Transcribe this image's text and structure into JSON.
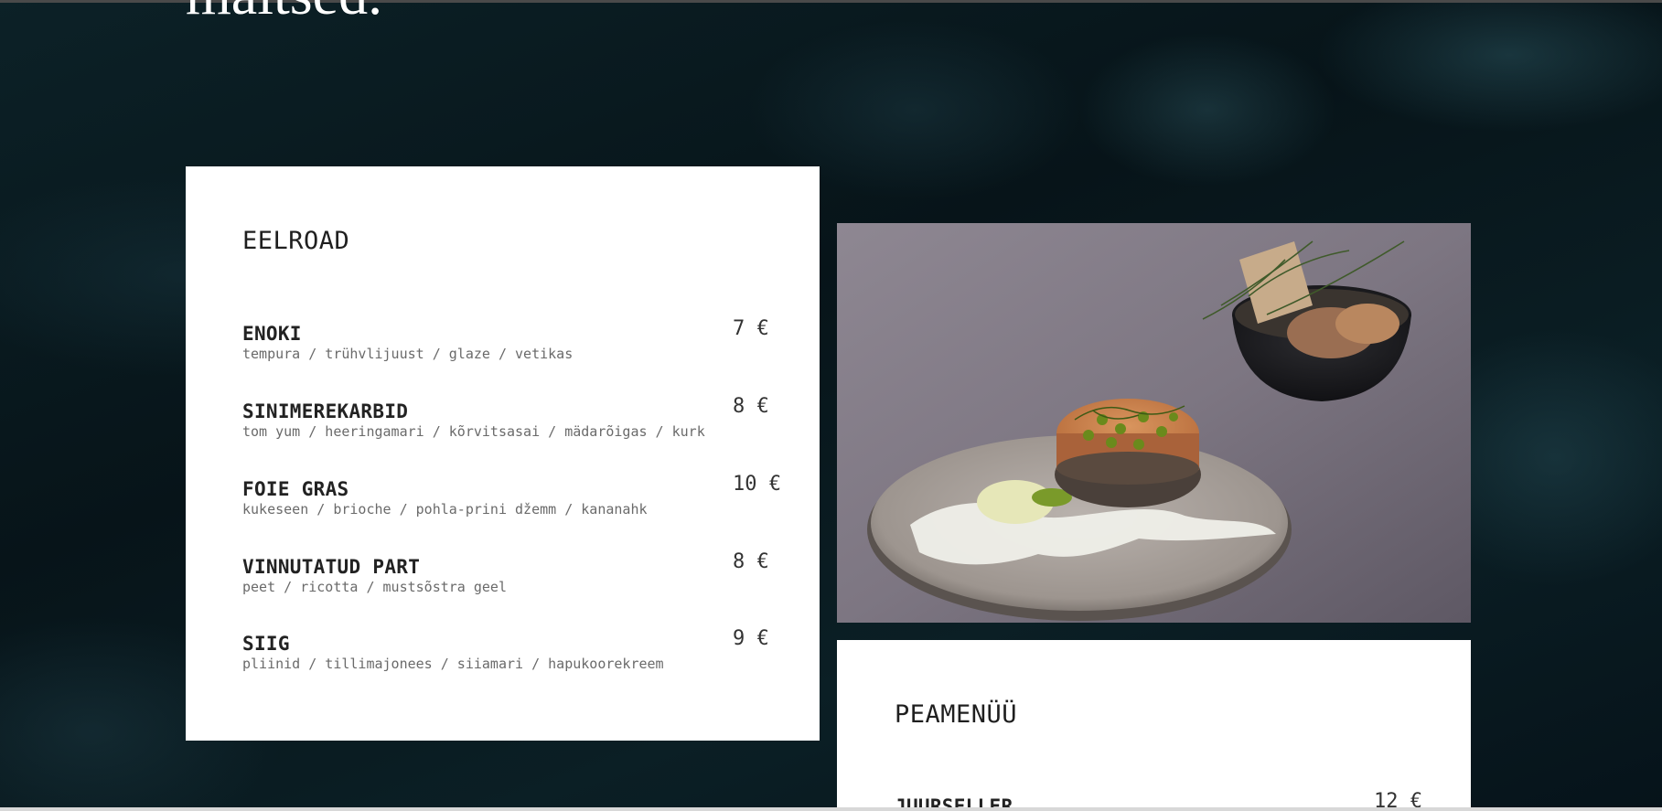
{
  "page": {
    "heading": "maitsed."
  },
  "starters": {
    "title": "EELROAD",
    "items": [
      {
        "name": "ENOKI",
        "desc": "tempura / trühvlijuust / glaze / vetikas",
        "price": "7 €"
      },
      {
        "name": "SINIMEREKARBID",
        "desc": "tom yum / heeringamari / kõrvitsasai / mädarõigas / kurk",
        "price": "8 €"
      },
      {
        "name": "FOIE GRAS",
        "desc": "kukeseen / brioche / pohla-prini džemm / kananahk",
        "price": "10 €"
      },
      {
        "name": "VINNUTATUD PART",
        "desc": "peet / ricotta / mustsõstra geel",
        "price": "8 €"
      },
      {
        "name": "SIIG",
        "desc": "pliinid / tillimajonees / siiamari / hapukoorekreem",
        "price": "9 €"
      }
    ]
  },
  "mains": {
    "title": "PEAMENÜÜ",
    "items": [
      {
        "name": "JUURSELLER",
        "price": "12 €"
      }
    ]
  },
  "photo": {
    "alt_icon": "food-photo-plate-and-bowl"
  },
  "colors": {
    "background": "#0a1a1f",
    "card": "#ffffff",
    "text": "#222222",
    "muted": "#6a6a6a"
  }
}
